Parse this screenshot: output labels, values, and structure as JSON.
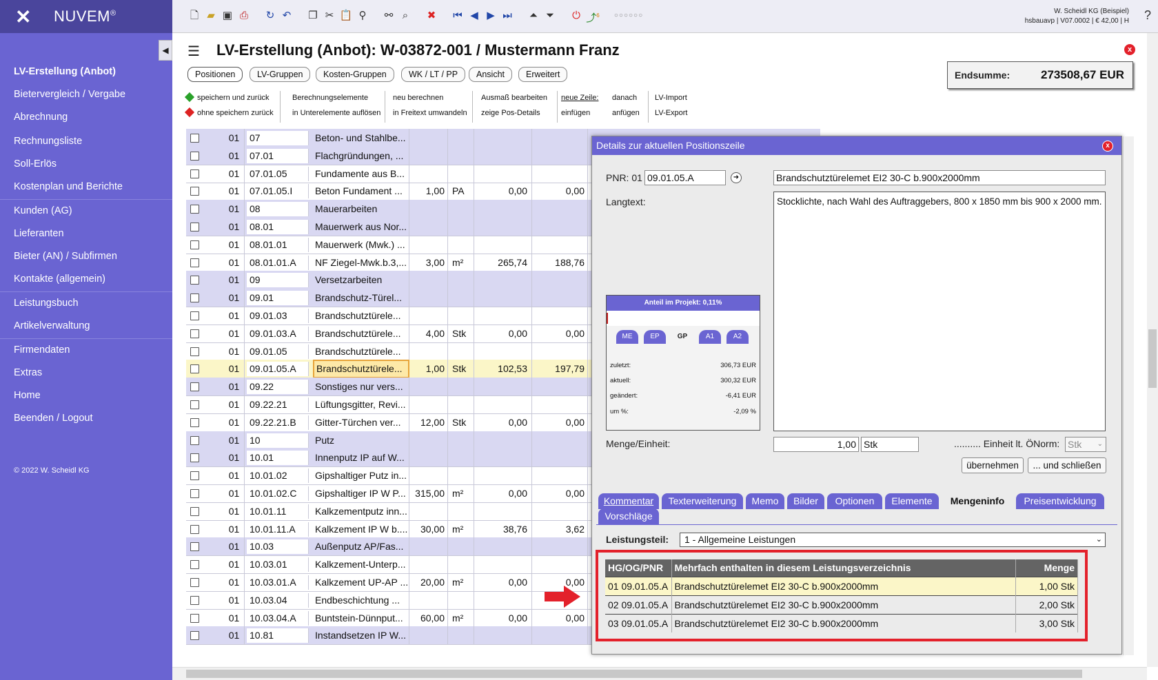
{
  "app": {
    "logo": "NUVEM",
    "logo_mark": "®"
  },
  "sidebar": {
    "items": [
      {
        "label": "LV-Erstellung (Anbot)"
      },
      {
        "label": "Bietervergleich / Vergabe"
      },
      {
        "label": "Abrechnung"
      },
      {
        "label": "Rechnungsliste"
      },
      {
        "label": "Soll-Erlös"
      },
      {
        "label": "Kostenplan und Berichte"
      },
      {
        "label": "Kunden (AG)"
      },
      {
        "label": "Lieferanten"
      },
      {
        "label": "Bieter (AN) / Subfirmen"
      },
      {
        "label": "Kontakte (allgemein)"
      },
      {
        "label": "Leistungsbuch"
      },
      {
        "label": "Artikelverwaltung"
      },
      {
        "label": "Firmendaten"
      },
      {
        "label": "Extras"
      },
      {
        "label": "Home"
      },
      {
        "label": "Beenden / Logout"
      }
    ],
    "copyright": "© 2022 W. Scheidl KG"
  },
  "topbar": {
    "company_line1": "W. Scheidl KG (Beispiel)",
    "company_line2": "hsbauavp | V07.0002 | € 42,00 | H",
    "help": "?",
    "dots": "○○○○○○",
    "badge": "6"
  },
  "header": {
    "title": "LV-Erstellung (Anbot): W-03872-001 / Mustermann Franz",
    "close": "x"
  },
  "tabs": [
    "Positionen",
    "LV-Gruppen",
    "Kosten-Gruppen",
    "WK / LT / PP",
    "Ansicht",
    "Erweitert"
  ],
  "endsumme": {
    "label": "Endsumme:",
    "value": "273508,67 EUR"
  },
  "actions": {
    "save_back": "speichern und zurück",
    "nosave_back": "ohne speichern zurück",
    "calc_elements": "Berechnungselemente",
    "dissolve": "in Unterelemente auflösen",
    "recalc": "neu berechnen",
    "to_freetext": "in Freitext umwandeln",
    "edit_measure": "Ausmaß bearbeiten",
    "show_details": "zeige Pos-Details",
    "new_line": "neue Zeile:",
    "insert": "einfügen",
    "after": "danach",
    "append": "anfügen",
    "import": "LV-Import",
    "export": "LV-Export"
  },
  "rows": [
    {
      "hg": "01",
      "pnr": "07",
      "text": "Beton- und Stahlbe...",
      "menge": "",
      "eh": "",
      "ep": "",
      "gp": "",
      "type": "group"
    },
    {
      "hg": "01",
      "pnr": "07.01",
      "text": "Flachgründungen, ...",
      "menge": "",
      "eh": "",
      "ep": "",
      "gp": "",
      "type": "group"
    },
    {
      "hg": "01",
      "pnr": "07.01.05",
      "text": "Fundamente aus B...",
      "menge": "",
      "eh": "",
      "ep": "",
      "gp": "",
      "type": "plain"
    },
    {
      "hg": "01",
      "pnr": "07.01.05.I",
      "text": "Beton Fundament ...",
      "menge": "1,00",
      "eh": "PA",
      "ep": "0,00",
      "gp": "0,00",
      "type": "plain"
    },
    {
      "hg": "01",
      "pnr": "08",
      "text": "Mauerarbeiten",
      "menge": "",
      "eh": "",
      "ep": "",
      "gp": "",
      "type": "group"
    },
    {
      "hg": "01",
      "pnr": "08.01",
      "text": "Mauerwerk aus Nor...",
      "menge": "",
      "eh": "",
      "ep": "",
      "gp": "",
      "type": "group"
    },
    {
      "hg": "01",
      "pnr": "08.01.01",
      "text": "Mauerwerk (Mwk.) ...",
      "menge": "",
      "eh": "",
      "ep": "",
      "gp": "",
      "type": "plain"
    },
    {
      "hg": "01",
      "pnr": "08.01.01.A",
      "text": "NF Ziegel-Mwk.b.3,...",
      "menge": "3,00",
      "eh": "m²",
      "ep": "265,74",
      "gp": "188,76",
      "type": "plain"
    },
    {
      "hg": "01",
      "pnr": "09",
      "text": "Versetzarbeiten",
      "menge": "",
      "eh": "",
      "ep": "",
      "gp": "",
      "type": "group"
    },
    {
      "hg": "01",
      "pnr": "09.01",
      "text": "Brandschutz-Türel...",
      "menge": "",
      "eh": "",
      "ep": "",
      "gp": "",
      "type": "group"
    },
    {
      "hg": "01",
      "pnr": "09.01.03",
      "text": "Brandschutztürele...",
      "menge": "",
      "eh": "",
      "ep": "",
      "gp": "",
      "type": "plain"
    },
    {
      "hg": "01",
      "pnr": "09.01.03.A",
      "text": "Brandschutztürele...",
      "menge": "4,00",
      "eh": "Stk",
      "ep": "0,00",
      "gp": "0,00",
      "type": "plain"
    },
    {
      "hg": "01",
      "pnr": "09.01.05",
      "text": "Brandschutztürele...",
      "menge": "",
      "eh": "",
      "ep": "",
      "gp": "",
      "type": "plain"
    },
    {
      "hg": "01",
      "pnr": "09.01.05.A",
      "text": "Brandschutztürele...",
      "menge": "1,00",
      "eh": "Stk",
      "ep": "102,53",
      "gp": "197,79",
      "type": "sel"
    },
    {
      "hg": "01",
      "pnr": "09.22",
      "text": "Sonstiges nur vers...",
      "menge": "",
      "eh": "",
      "ep": "",
      "gp": "",
      "type": "group"
    },
    {
      "hg": "01",
      "pnr": "09.22.21",
      "text": "Lüftungsgitter, Revi...",
      "menge": "",
      "eh": "",
      "ep": "",
      "gp": "",
      "type": "plain"
    },
    {
      "hg": "01",
      "pnr": "09.22.21.B",
      "text": "Gitter-Türchen ver...",
      "menge": "12,00",
      "eh": "Stk",
      "ep": "0,00",
      "gp": "0,00",
      "type": "plain"
    },
    {
      "hg": "01",
      "pnr": "10",
      "text": "Putz",
      "menge": "",
      "eh": "",
      "ep": "",
      "gp": "",
      "type": "group"
    },
    {
      "hg": "01",
      "pnr": "10.01",
      "text": "Innenputz IP auf W...",
      "menge": "",
      "eh": "",
      "ep": "",
      "gp": "",
      "type": "group"
    },
    {
      "hg": "01",
      "pnr": "10.01.02",
      "text": "Gipshaltiger Putz in...",
      "menge": "",
      "eh": "",
      "ep": "",
      "gp": "",
      "type": "plain"
    },
    {
      "hg": "01",
      "pnr": "10.01.02.C",
      "text": "Gipshaltiger IP W P...",
      "menge": "315,00",
      "eh": "m²",
      "ep": "0,00",
      "gp": "0,00",
      "type": "plain"
    },
    {
      "hg": "01",
      "pnr": "10.01.11",
      "text": "Kalkzementputz inn...",
      "menge": "",
      "eh": "",
      "ep": "",
      "gp": "",
      "type": "plain"
    },
    {
      "hg": "01",
      "pnr": "10.01.11.A",
      "text": "Kalkzement IP W b....",
      "menge": "30,00",
      "eh": "m²",
      "ep": "38,76",
      "gp": "3,62",
      "type": "plain"
    },
    {
      "hg": "01",
      "pnr": "10.03",
      "text": "Außenputz AP/Fas...",
      "menge": "",
      "eh": "",
      "ep": "",
      "gp": "",
      "type": "group"
    },
    {
      "hg": "01",
      "pnr": "10.03.01",
      "text": "Kalkzement-Unterp...",
      "menge": "",
      "eh": "",
      "ep": "",
      "gp": "",
      "type": "plain"
    },
    {
      "hg": "01",
      "pnr": "10.03.01.A",
      "text": "Kalkzement UP-AP ...",
      "menge": "20,00",
      "eh": "m²",
      "ep": "0,00",
      "gp": "0,00",
      "type": "plain"
    },
    {
      "hg": "01",
      "pnr": "10.03.04",
      "text": "Endbeschichtung ...",
      "menge": "",
      "eh": "",
      "ep": "",
      "gp": "",
      "type": "plain"
    },
    {
      "hg": "01",
      "pnr": "10.03.04.A",
      "text": "Buntstein-Dünnput...",
      "menge": "60,00",
      "eh": "m²",
      "ep": "0,00",
      "gp": "0,00",
      "type": "plain"
    },
    {
      "hg": "01",
      "pnr": "10.81",
      "text": "Instandsetzen IP W...",
      "menge": "",
      "eh": "",
      "ep": "",
      "gp": "",
      "type": "group"
    }
  ],
  "dialog": {
    "title": "Details zur aktuellen Positionszeile",
    "close": "x",
    "pnr_label": "PNR: 01",
    "pnr_value": "09.01.05.A",
    "short_text": "Brandschutztürelemet EI2 30-C b.900x2000mm",
    "langtext_label": "Langtext:",
    "langtext": "Stocklichte, nach Wahl des Auftraggebers, 800 x 1850 mm bis 900 x 2000 mm.",
    "anteil_title": "Anteil im Projekt: 0,11%",
    "anteil_fraction": 0.0011,
    "pills": [
      "ME",
      "EP",
      "GP",
      "A1",
      "A2"
    ],
    "stats": [
      {
        "label": "zuletzt:",
        "value": "306,73 EUR"
      },
      {
        "label": "aktuell:",
        "value": "300,32 EUR"
      },
      {
        "label": "geändert:",
        "value": "-6,41 EUR"
      },
      {
        "label": "um %:",
        "value": "-2,09 %"
      }
    ],
    "menge_label": "Menge/Einheit:",
    "menge_value": "1,00",
    "einheit_value": "Stk",
    "oenorm_label": ".......... Einheit lt. ÖNorm:",
    "oenorm_value": "Stk",
    "btn_apply": "übernehmen",
    "btn_apply_close": "... und schließen",
    "tabs": [
      "Kommentar",
      "Texterweiterung",
      "Memo",
      "Bilder",
      "Optionen",
      "Elemente",
      "Mengeninfo",
      "Preisentwicklung",
      "Vorschläge"
    ],
    "leistungsteil_label": "Leistungsteil:",
    "leistungsteil_value": "1 - Allgemeine Leistungen",
    "table_headers": [
      "HG/OG/PNR",
      "Mehrfach enthalten in diesem Leistungsverzeichnis",
      "Menge"
    ],
    "table_rows": [
      [
        "01 09.01.05.A",
        "Brandschutztürelemet EI2 30-C b.900x2000mm",
        "1,00 Stk"
      ],
      [
        "02 09.01.05.A",
        "Brandschutztürelemet EI2 30-C b.900x2000mm",
        "2,00 Stk"
      ],
      [
        "03 09.01.05.A",
        "Brandschutztürelemet EI2 30-C b.900x2000mm",
        "3,00 Stk"
      ]
    ]
  },
  "colors": {
    "accent": "#6a64d2",
    "highlight": "#fbf6c8",
    "alert": "#e3212b"
  }
}
